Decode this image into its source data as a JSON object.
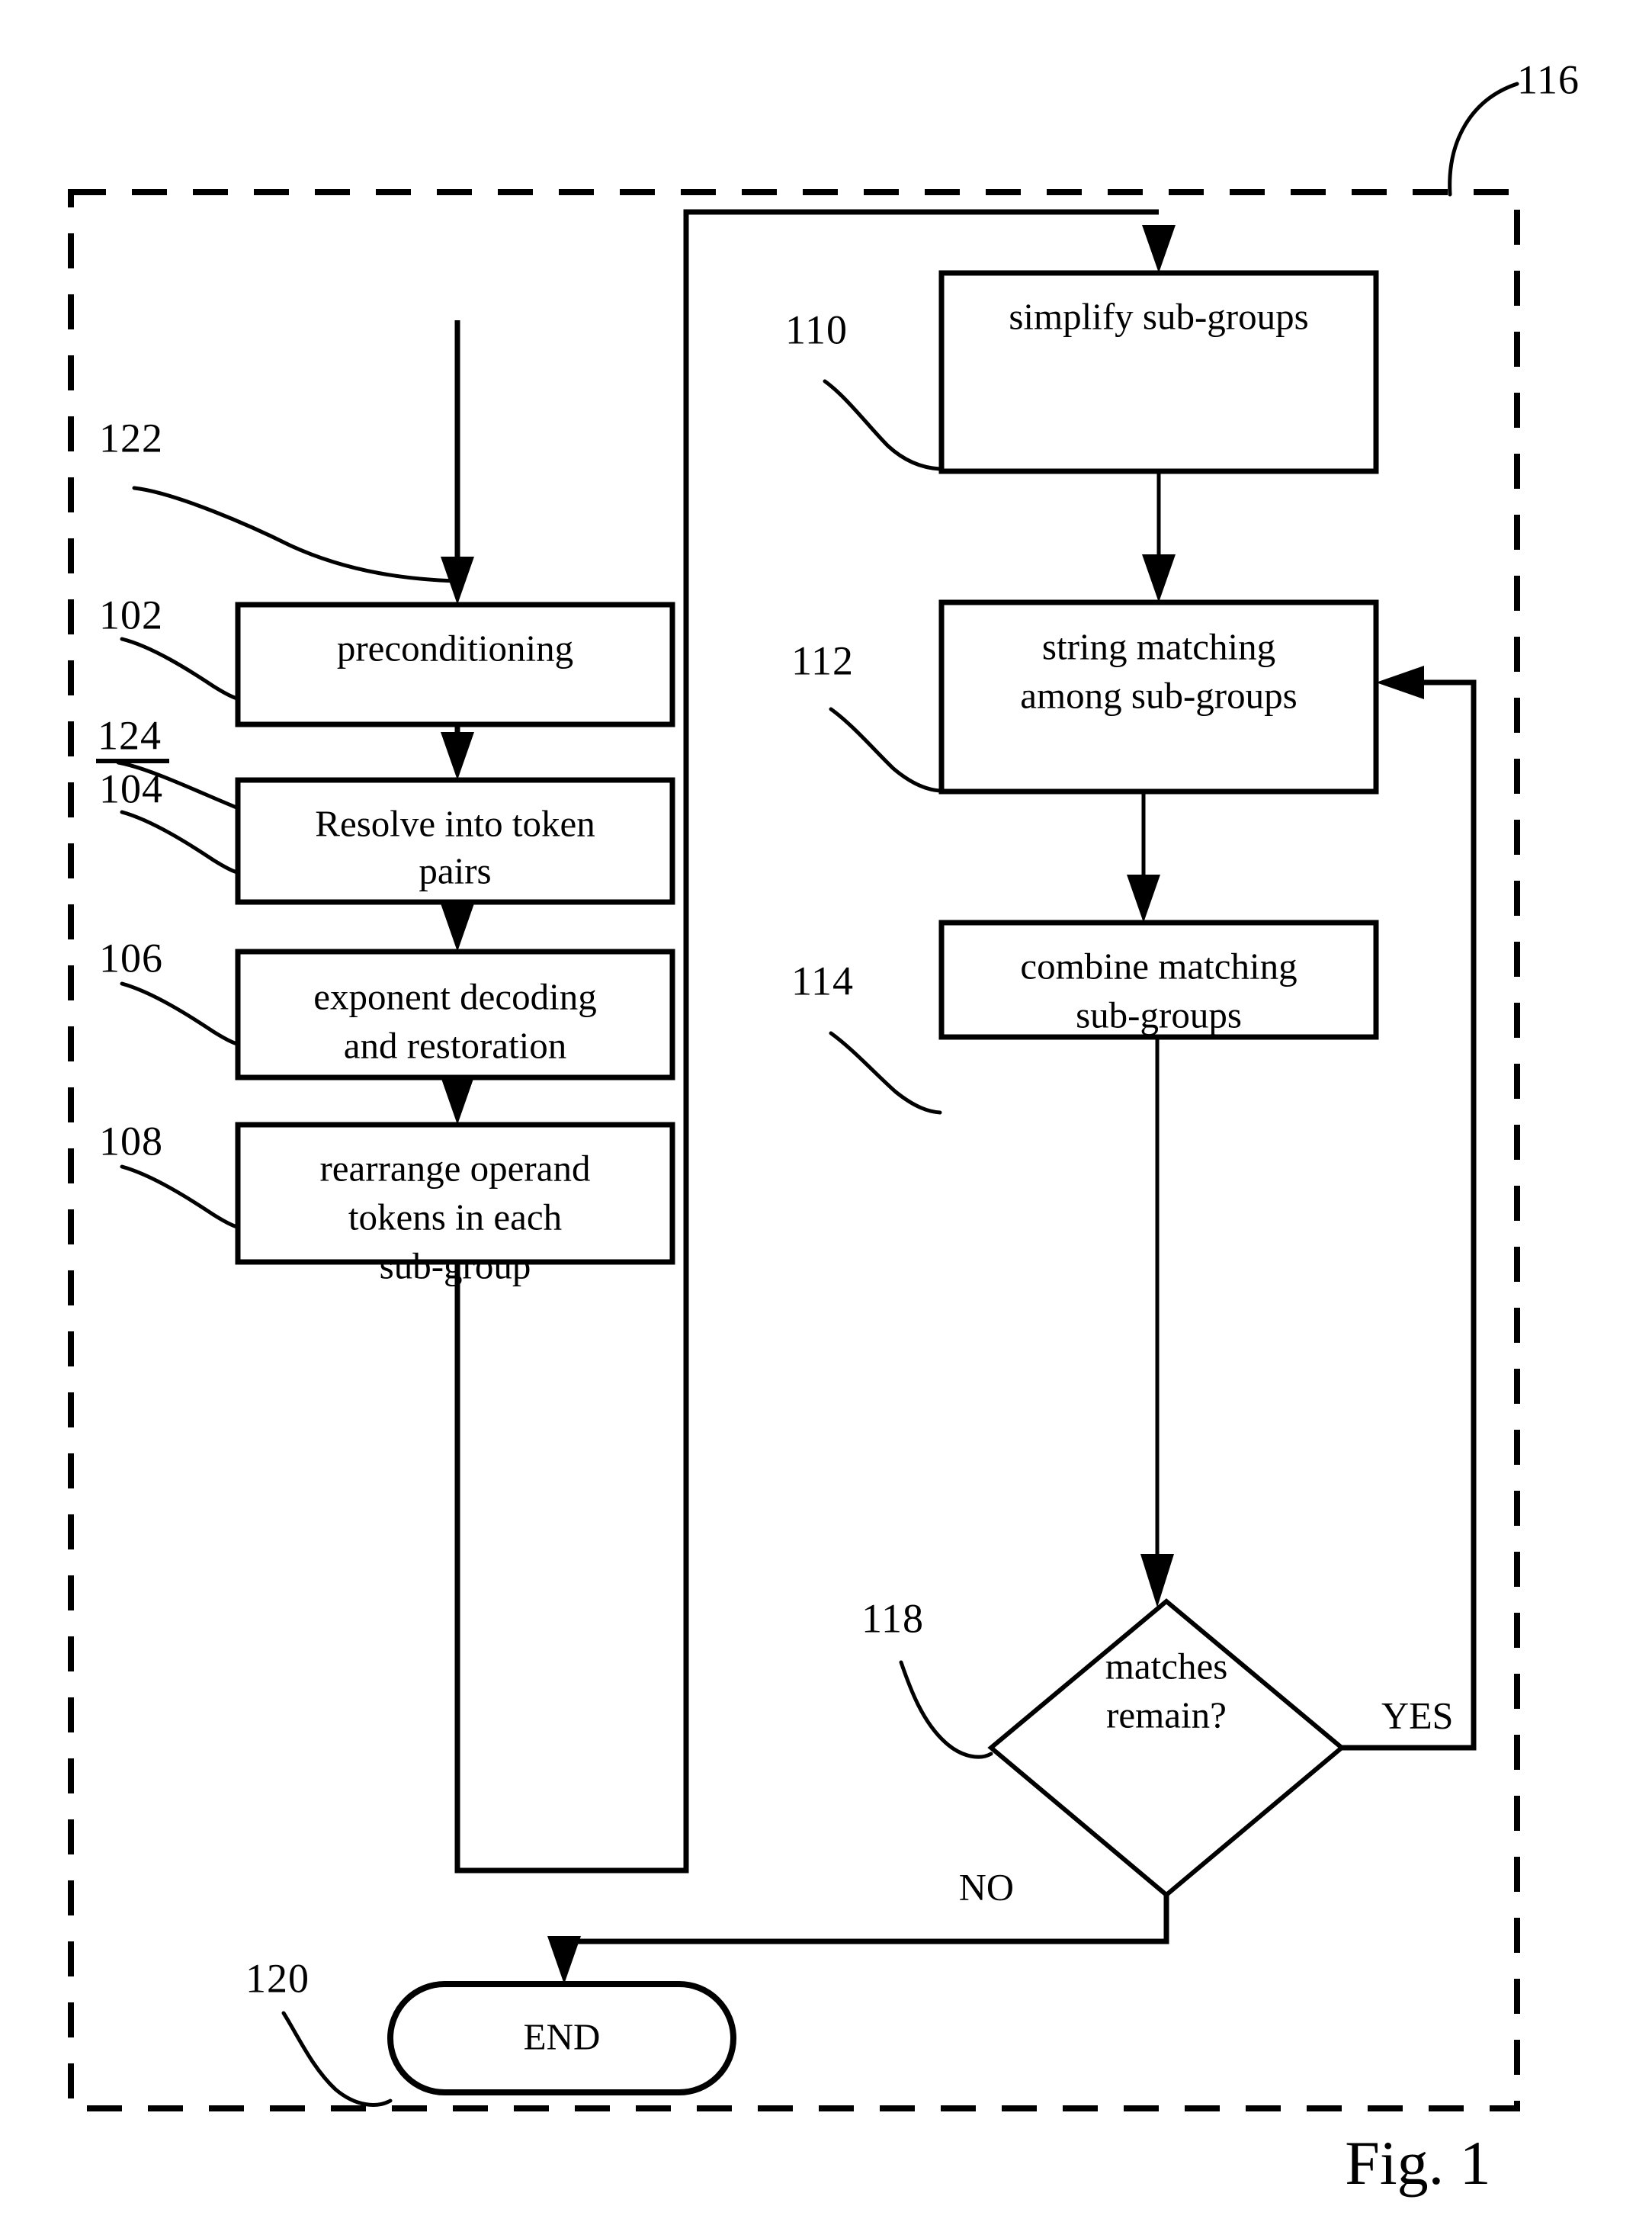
{
  "figure": {
    "caption": "Fig. 1",
    "outer_ref": "116"
  },
  "nodes": [
    {
      "ref": "102",
      "label_line1": "preconditioning",
      "label_line2": "",
      "label_line3": "",
      "shape": "process"
    },
    {
      "ref": "104",
      "label_line1": "Resolve into token",
      "label_line2": "pairs",
      "label_line3": "",
      "shape": "process"
    },
    {
      "ref": "106",
      "label_line1": "exponent decoding",
      "label_line2": "and restoration",
      "label_line3": "",
      "shape": "process"
    },
    {
      "ref": "108",
      "label_line1": "rearrange operand",
      "label_line2": "tokens in each",
      "label_line3": "sub-group",
      "shape": "process"
    },
    {
      "ref": "110",
      "label_line1": "simplify sub-groups",
      "label_line2": "",
      "label_line3": "",
      "shape": "process"
    },
    {
      "ref": "112",
      "label_line1": "string matching",
      "label_line2": "among sub-groups",
      "label_line3": "",
      "shape": "process"
    },
    {
      "ref": "114",
      "label_line1": "combine matching",
      "label_line2": "sub-groups",
      "label_line3": "",
      "shape": "process"
    },
    {
      "ref": "118",
      "label_line1": "matches",
      "label_line2": "remain?",
      "label_line3": "",
      "shape": "decision"
    },
    {
      "ref": "120",
      "label_line1": "END",
      "label_line2": "",
      "label_line3": "",
      "shape": "terminator"
    }
  ],
  "leader_refs": {
    "r122": "122",
    "r124": "124",
    "r102": "102",
    "r104": "104",
    "r106": "106",
    "r108": "108",
    "r110": "110",
    "r112": "112",
    "r114": "114",
    "r116": "116",
    "r118": "118",
    "r120": "120"
  },
  "branch_labels": {
    "yes": "YES",
    "no": "NO"
  }
}
